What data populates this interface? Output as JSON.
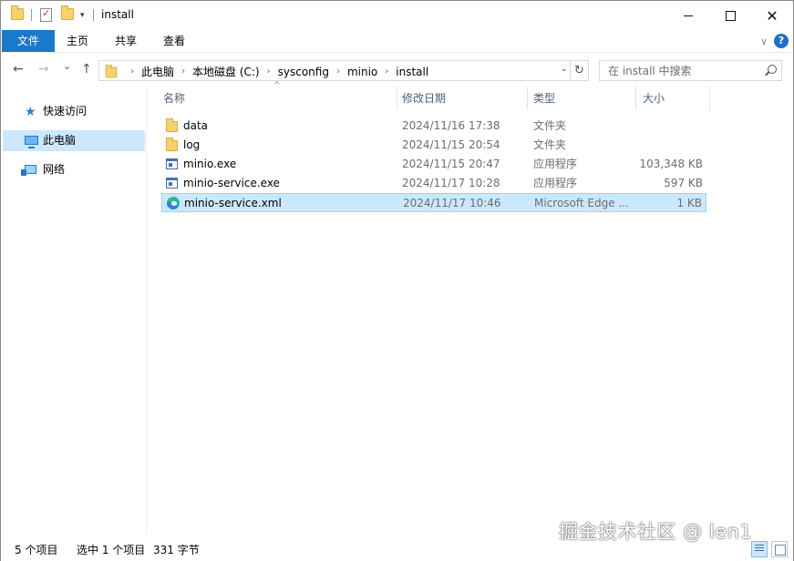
{
  "window": {
    "title": "install",
    "controls": {
      "minimize_icon": "minimize-icon",
      "maximize_icon": "maximize-icon",
      "close_glyph": "✕"
    }
  },
  "quick_access_toolbar": {
    "icons": [
      "folder-icon",
      "properties-icon",
      "new-folder-icon",
      "customize-dropdown-icon"
    ],
    "dropdown_glyph": "▾"
  },
  "ribbon": {
    "tabs": [
      "文件",
      "主页",
      "共享",
      "查看"
    ],
    "expand_glyph": "∨",
    "help_glyph": "?"
  },
  "navigation": {
    "back_glyph": "←",
    "forward_glyph": "→",
    "recent_glyph": "⌄",
    "up_glyph": "↑",
    "breadcrumb": [
      "此电脑",
      "本地磁盘 (C:)",
      "sysconfig",
      "minio",
      "install"
    ],
    "crumb_sep": "›",
    "address_dropdown_glyph": "⌄",
    "refresh_glyph": "↻"
  },
  "search": {
    "placeholder": "在 install 中搜索"
  },
  "nav_pane": {
    "items": [
      {
        "label": "快速访问",
        "icon": "star-icon"
      },
      {
        "label": "此电脑",
        "icon": "computer-icon",
        "selected": true
      },
      {
        "label": "网络",
        "icon": "network-icon"
      }
    ]
  },
  "columns": {
    "name": "名称",
    "date": "修改日期",
    "type": "类型",
    "size": "大小",
    "sort_glyph": "^"
  },
  "files": [
    {
      "name": "data",
      "date": "2024/11/16 17:38",
      "type": "文件夹",
      "size": "",
      "icon": "folder"
    },
    {
      "name": "log",
      "date": "2024/11/15 20:54",
      "type": "文件夹",
      "size": "",
      "icon": "folder"
    },
    {
      "name": "minio.exe",
      "date": "2024/11/15 20:47",
      "type": "应用程序",
      "size": "103,348 KB",
      "icon": "exe"
    },
    {
      "name": "minio-service.exe",
      "date": "2024/11/17 10:28",
      "type": "应用程序",
      "size": "597 KB",
      "icon": "exe"
    },
    {
      "name": "minio-service.xml",
      "date": "2024/11/17 10:46",
      "type": "Microsoft Edge ...",
      "size": "1 KB",
      "icon": "edge",
      "selected": true
    }
  ],
  "status": {
    "item_count": "5 个项目",
    "selection": "选中 1 个项目",
    "selection_size": "331 字节"
  },
  "watermark": "掘金技术社区 @ len1"
}
